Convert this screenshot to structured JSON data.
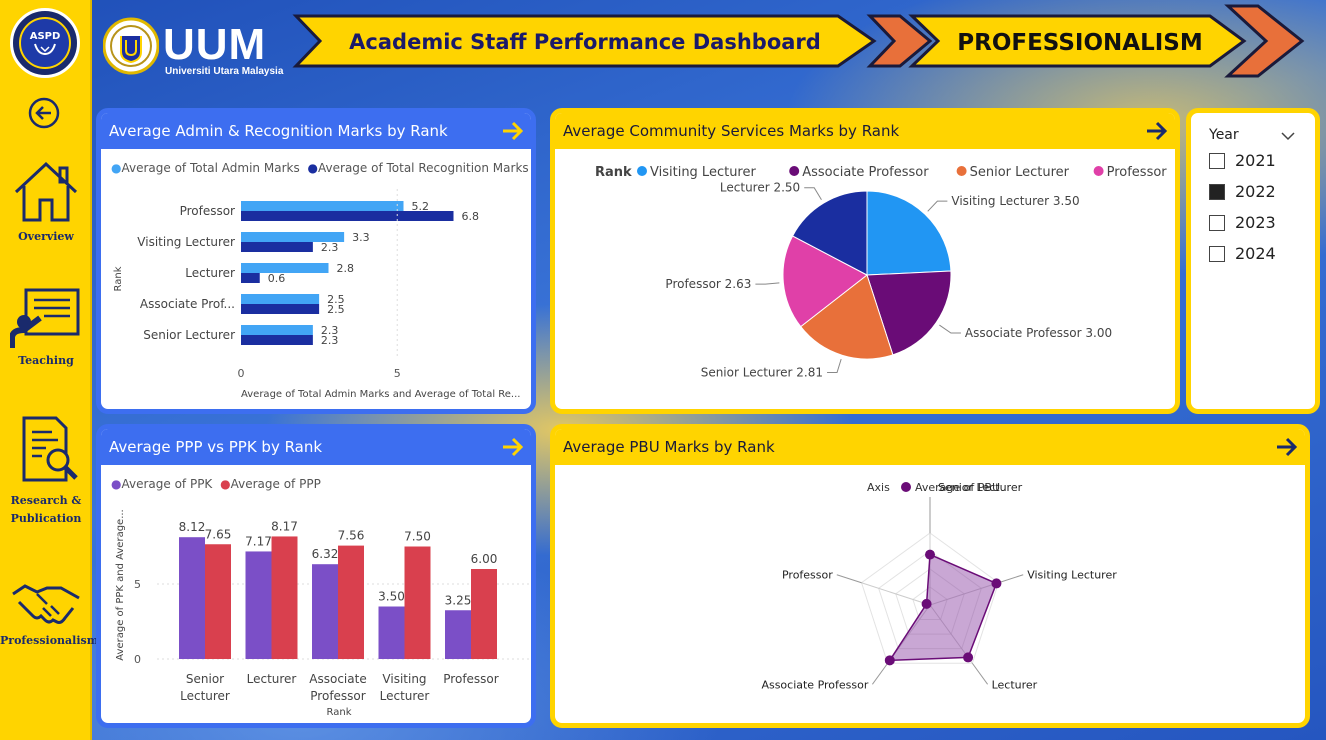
{
  "sidebar": {
    "logo_text": "ASPD",
    "items": [
      {
        "label": "Overview"
      },
      {
        "label": "Teaching"
      },
      {
        "label": "Research & Publication"
      },
      {
        "label": "Professionalism"
      }
    ]
  },
  "header": {
    "uum_title": "UUM",
    "uum_subtitle": "Universiti Utara Malaysia",
    "dashboard_title": "Academic Staff Performance Dashboard",
    "page_title": "PROFESSIONALISM"
  },
  "colors": {
    "sidebar": "#ffd400",
    "accent_blue": "#3d6ef0",
    "bar_light": "#42a5f5",
    "bar_dark": "#1a2ea0",
    "ppk": "#7b4fc7",
    "ppp": "#d9404e",
    "pbu": "#6a0c77"
  },
  "slicer": {
    "title": "Year",
    "options": [
      {
        "label": "2021",
        "checked": false
      },
      {
        "label": "2022",
        "checked": true
      },
      {
        "label": "2023",
        "checked": false
      },
      {
        "label": "2024",
        "checked": false
      }
    ]
  },
  "chart_data": [
    {
      "id": "admin_recognition",
      "type": "bar",
      "orientation": "horizontal",
      "title": "Average Admin & Recognition Marks by Rank",
      "xlabel": "Average of Total Admin Marks and Average of Total Re...",
      "ylabel": "Rank",
      "categories": [
        "Professor",
        "Visiting Lecturer",
        "Lecturer",
        "Associate Prof...",
        "Senior Lecturer"
      ],
      "series": [
        {
          "name": "Average of Total Admin Marks",
          "values": [
            5.2,
            3.3,
            2.8,
            2.5,
            2.3
          ]
        },
        {
          "name": "Average of Total Recognition Marks",
          "values": [
            6.8,
            2.3,
            0.6,
            2.5,
            2.3
          ]
        }
      ],
      "labels": [
        [
          "5.2",
          "3.3",
          "2.8",
          "2.5",
          "2.3"
        ],
        [
          "6.8",
          "2.3",
          "0.6",
          "2.5",
          "2.3"
        ]
      ],
      "xticks": [
        "0",
        "5"
      ],
      "xlim": [
        0,
        8
      ]
    },
    {
      "id": "community",
      "type": "pie",
      "title": "Average Community Services Marks by Rank",
      "legend_title": "Rank",
      "slices": [
        {
          "name": "Visiting Lecturer",
          "value": 3.5,
          "label": "Visiting Lecturer 3.50",
          "color": "#2196f3"
        },
        {
          "name": "Associate Professor",
          "value": 3.0,
          "label": "Associate Professor 3.00",
          "color": "#6a0c77"
        },
        {
          "name": "Senior Lecturer",
          "value": 2.81,
          "label": "Senior Lecturer 2.81",
          "color": "#e8703a"
        },
        {
          "name": "Professor",
          "value": 2.63,
          "label": "Professor 2.63",
          "color": "#e040a8"
        },
        {
          "name": "Lecturer",
          "value": 2.5,
          "label": "Lecturer 2.50",
          "color": "#1a2ea0"
        }
      ]
    },
    {
      "id": "ppp_ppk",
      "type": "bar",
      "orientation": "vertical",
      "title": "Average PPP vs PPK by Rank",
      "xlabel": "Rank",
      "ylabel": "Average of PPK and Average...",
      "categories": [
        [
          "Senior",
          "Lecturer"
        ],
        [
          "Lecturer"
        ],
        [
          "Associate",
          "Professor"
        ],
        [
          "Visiting",
          "Lecturer"
        ],
        [
          "Professor"
        ]
      ],
      "series": [
        {
          "name": "Average of PPK",
          "values": [
            8.12,
            7.17,
            6.32,
            3.5,
            3.25
          ]
        },
        {
          "name": "Average of PPP",
          "values": [
            7.65,
            8.17,
            7.56,
            7.5,
            6.0
          ]
        }
      ],
      "labels": [
        [
          "8.12",
          "7.17",
          "6.32",
          "3.50",
          "3.25"
        ],
        [
          "7.65",
          "8.17",
          "7.56",
          "7.50",
          "6.00"
        ]
      ],
      "yticks": [
        "0",
        "5"
      ],
      "ylim": [
        0,
        10
      ]
    },
    {
      "id": "pbu",
      "type": "radar",
      "title": "Average PBU Marks by Rank",
      "legend_title": "Axis",
      "series_name": "Average of PBU",
      "axes": [
        "Senior Lecturer",
        "Visiting Lecturer",
        "Lecturer",
        "Associate Professor",
        "Professor"
      ],
      "values": [
        0.7,
        0.97,
        0.9,
        0.95,
        0.05
      ],
      "max": 1
    }
  ]
}
